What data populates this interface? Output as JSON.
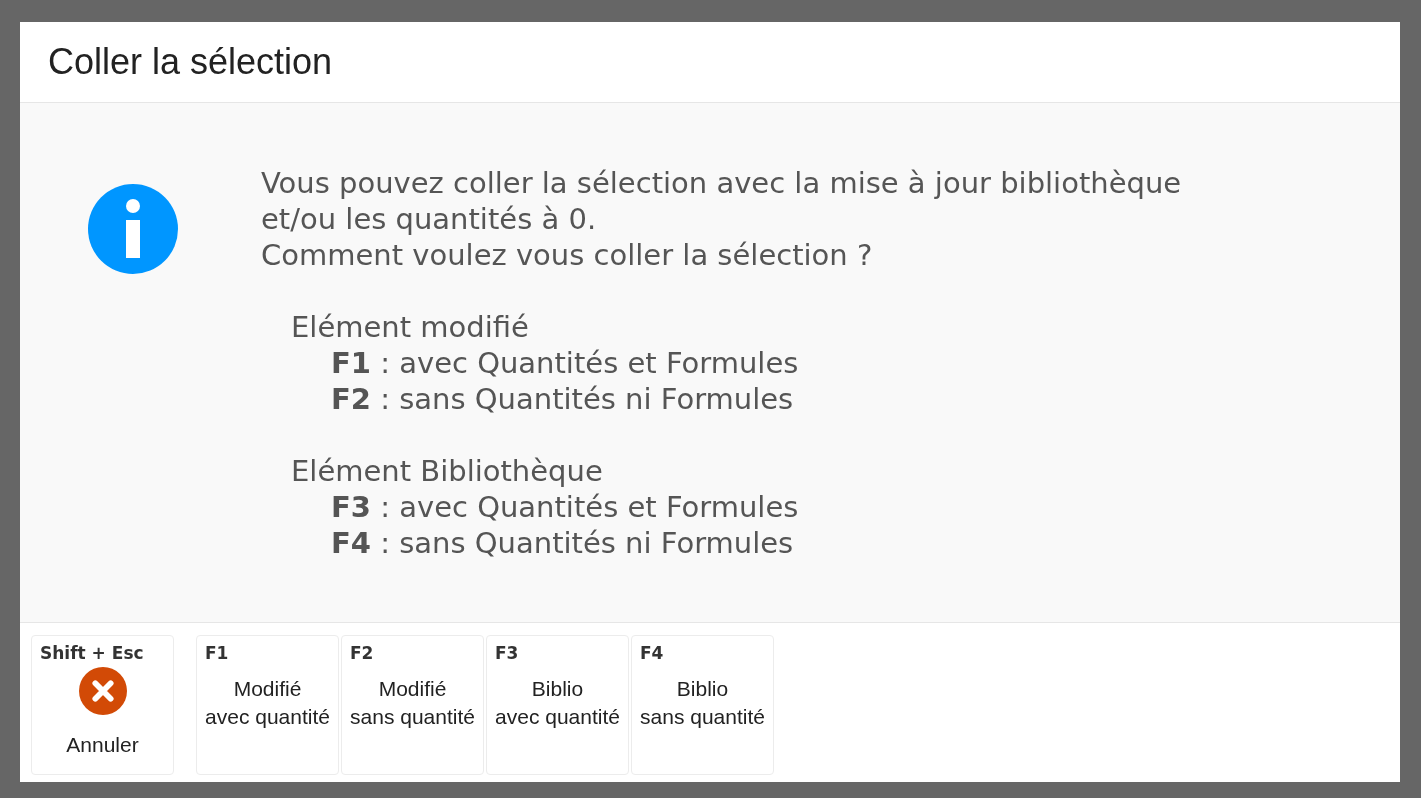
{
  "dialog": {
    "title": "Coller la sélection"
  },
  "message": {
    "lines": [
      "Vous pouvez coller la sélection avec la mise à jour bibliothèque",
      "et/ou les quantités à 0.",
      "Comment voulez vous coller la sélection ?"
    ]
  },
  "option_groups": [
    {
      "heading": "Elément modifié",
      "items": [
        "**F1** : avec Quantités et Formules",
        "**F2** : sans Quantités ni Formules"
      ]
    },
    {
      "heading": "Elément Bibliothèque",
      "items": [
        "**F3** : avec Quantités et Formules",
        "**F4** : sans Quantités ni Formules"
      ]
    }
  ],
  "buttons": [
    {
      "kind": "cancel",
      "shortcut": "Shift + Esc",
      "label": [
        "Annuler"
      ]
    },
    {
      "kind": "key",
      "shortcut": "F1",
      "label": [
        "Modifié",
        "avec quantité"
      ]
    },
    {
      "kind": "key",
      "shortcut": "F2",
      "label": [
        "Modifié",
        "sans quantité"
      ]
    },
    {
      "kind": "key",
      "shortcut": "F3",
      "label": [
        "Biblio",
        "avec quantité"
      ]
    },
    {
      "kind": "key",
      "shortcut": "F4",
      "label": [
        "Biblio",
        "sans quantité"
      ]
    }
  ]
}
